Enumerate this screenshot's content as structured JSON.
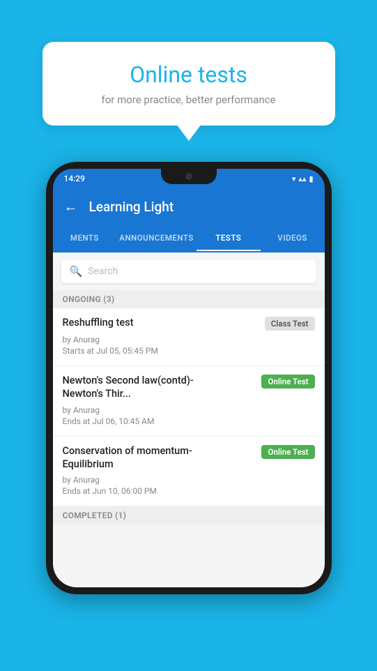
{
  "background_color": "#1ab4e8",
  "bubble": {
    "title": "Online tests",
    "subtitle": "for more practice, better performance"
  },
  "phone": {
    "status_bar": {
      "time": "14:29",
      "icons": [
        "▾",
        "▴",
        "▮"
      ]
    },
    "app_bar": {
      "back_label": "←",
      "title": "Learning Light"
    },
    "tabs": [
      {
        "label": "MENTS",
        "active": false
      },
      {
        "label": "ANNOUNCEMENTS",
        "active": false
      },
      {
        "label": "TESTS",
        "active": true
      },
      {
        "label": "VIDEOS",
        "active": false
      }
    ],
    "search": {
      "placeholder": "Search"
    },
    "ongoing_section": {
      "header": "ONGOING (3)",
      "tests": [
        {
          "title": "Reshuffling test",
          "badge": "Class Test",
          "badge_type": "class",
          "author": "by Anurag",
          "time_label": "Starts at",
          "time": "Jul 05, 05:45 PM"
        },
        {
          "title": "Newton's Second law(contd)-Newton's Thir...",
          "badge": "Online Test",
          "badge_type": "online",
          "author": "by Anurag",
          "time_label": "Ends at",
          "time": "Jul 06, 10:45 AM"
        },
        {
          "title": "Conservation of momentum-Equilibrium",
          "badge": "Online Test",
          "badge_type": "online",
          "author": "by Anurag",
          "time_label": "Ends at",
          "time": "Jun 10, 06:00 PM"
        }
      ]
    },
    "completed_section": {
      "header": "COMPLETED (1)"
    }
  }
}
